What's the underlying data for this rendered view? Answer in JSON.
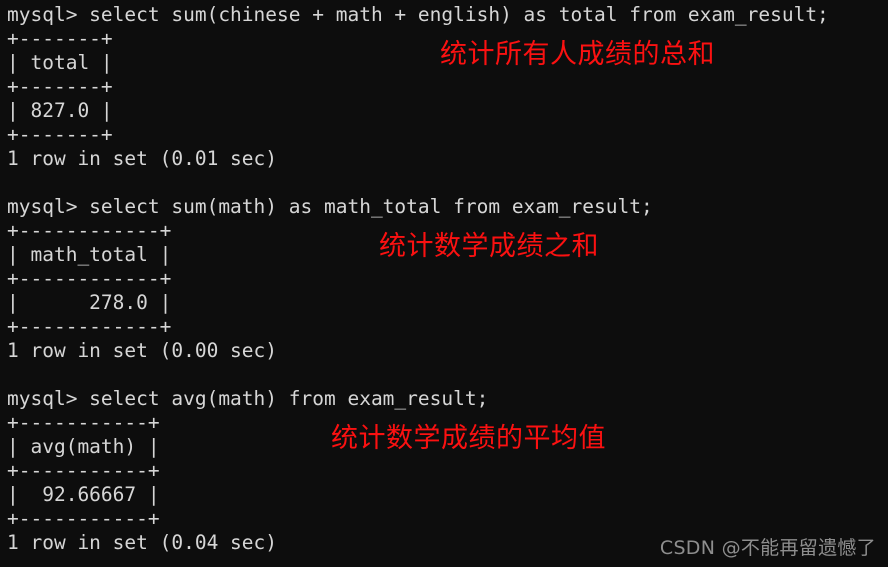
{
  "terminal": {
    "background_color": "#0d0d0d",
    "text_color": "#d6d6d6",
    "prompt": "mysql> ",
    "lines": [
      "mysql> select sum(chinese + math + english) as total from exam_result;",
      "+-------+",
      "| total |",
      "+-------+",
      "| 827.0 |",
      "+-------+",
      "1 row in set (0.01 sec)",
      "",
      "mysql> select sum(math) as math_total from exam_result;",
      "+------------+",
      "| math_total |",
      "+------------+",
      "|      278.0 |",
      "+------------+",
      "1 row in set (0.00 sec)",
      "",
      "mysql> select avg(math) from exam_result;",
      "+-----------+",
      "| avg(math) |",
      "+-----------+",
      "|  92.66667 |",
      "+-----------+",
      "1 row in set (0.04 sec)"
    ],
    "queries": [
      {
        "command": "select sum(chinese + math + english) as total from exam_result;",
        "column": "total",
        "value": "827.0",
        "status": "1 row in set (0.01 sec)"
      },
      {
        "command": "select sum(math) as math_total from exam_result;",
        "column": "math_total",
        "value": "278.0",
        "status": "1 row in set (0.00 sec)"
      },
      {
        "command": "select avg(math) from exam_result;",
        "column": "avg(math)",
        "value": "92.66667",
        "status": "1 row in set (0.04 sec)"
      }
    ]
  },
  "annotations": {
    "color": "#fb1111",
    "items": [
      {
        "text": "统计所有人成绩的总和"
      },
      {
        "text": "统计数学成绩之和"
      },
      {
        "text": "统计数学成绩的平均值"
      }
    ]
  },
  "watermark": {
    "text": "CSDN @不能再留遗憾了",
    "color": "#8e8e8e"
  }
}
